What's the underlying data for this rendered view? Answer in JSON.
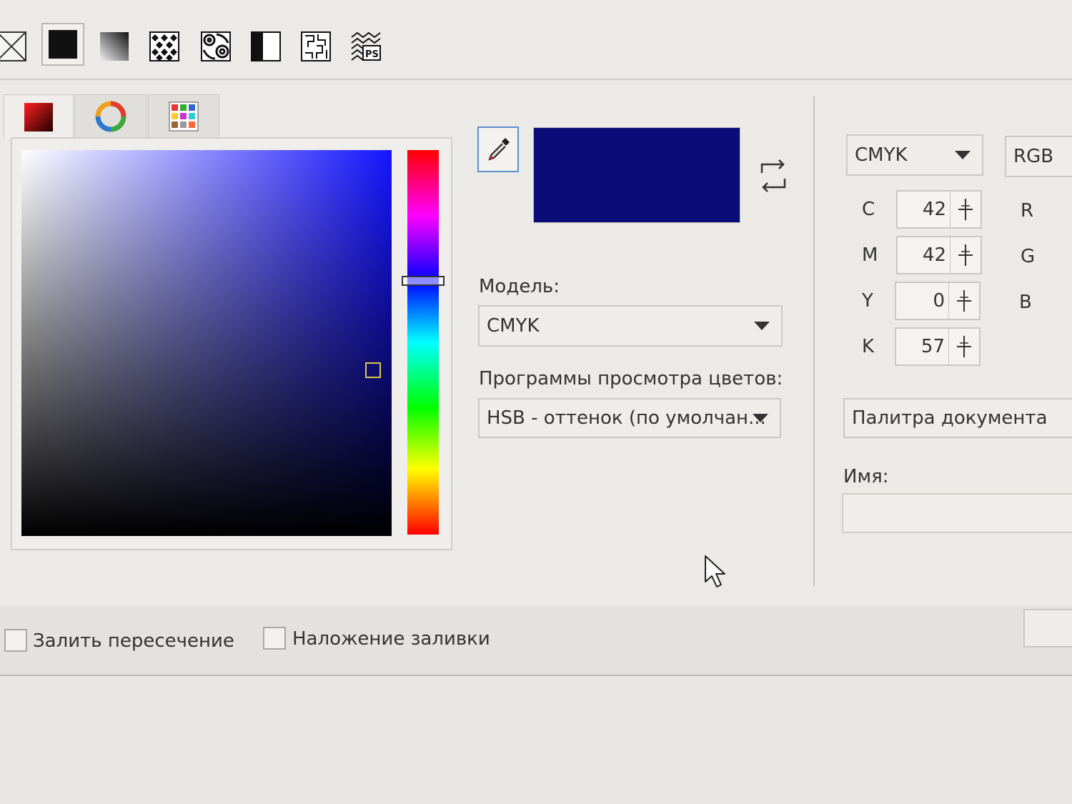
{
  "toolbar": {
    "items": [
      {
        "name": "no-fill-icon"
      },
      {
        "name": "uniform-fill-icon",
        "active": true
      },
      {
        "name": "fountain-fill-icon"
      },
      {
        "name": "vector-pattern-icon"
      },
      {
        "name": "bitmap-pattern-icon"
      },
      {
        "name": "two-color-pattern-icon"
      },
      {
        "name": "texture-fill-icon"
      },
      {
        "name": "postscript-fill-icon"
      }
    ]
  },
  "tabs": [
    {
      "name": "color-viewers-tab-icon",
      "active": true
    },
    {
      "name": "color-harmonies-tab-icon"
    },
    {
      "name": "color-palettes-tab-icon"
    }
  ],
  "current_color": "#0b0c78",
  "hue_color": "#1515ff",
  "hue_level": 0.34,
  "marker_level": {
    "saturation": 0.95,
    "brightness": 0.57
  },
  "model": {
    "label": "Модель:",
    "value": "CMYK"
  },
  "viewers": {
    "label": "Программы просмотра цветов:",
    "value": "HSB - оттенок (по умолчан..."
  },
  "right_panel": {
    "model_select": "CMYK",
    "secondary_model": "RGB",
    "cmyk": [
      {
        "label": "C",
        "value": "42"
      },
      {
        "label": "M",
        "value": "42"
      },
      {
        "label": "Y",
        "value": "0"
      },
      {
        "label": "K",
        "value": "57"
      }
    ],
    "rgb_labels": [
      "R",
      "G",
      "B"
    ],
    "palette": "Палитра документа",
    "name_label": "Имя:",
    "name_value": ""
  },
  "bottom": {
    "fill_intersection": "Залить пересечение",
    "fill_overlay": "Наложение заливки"
  }
}
